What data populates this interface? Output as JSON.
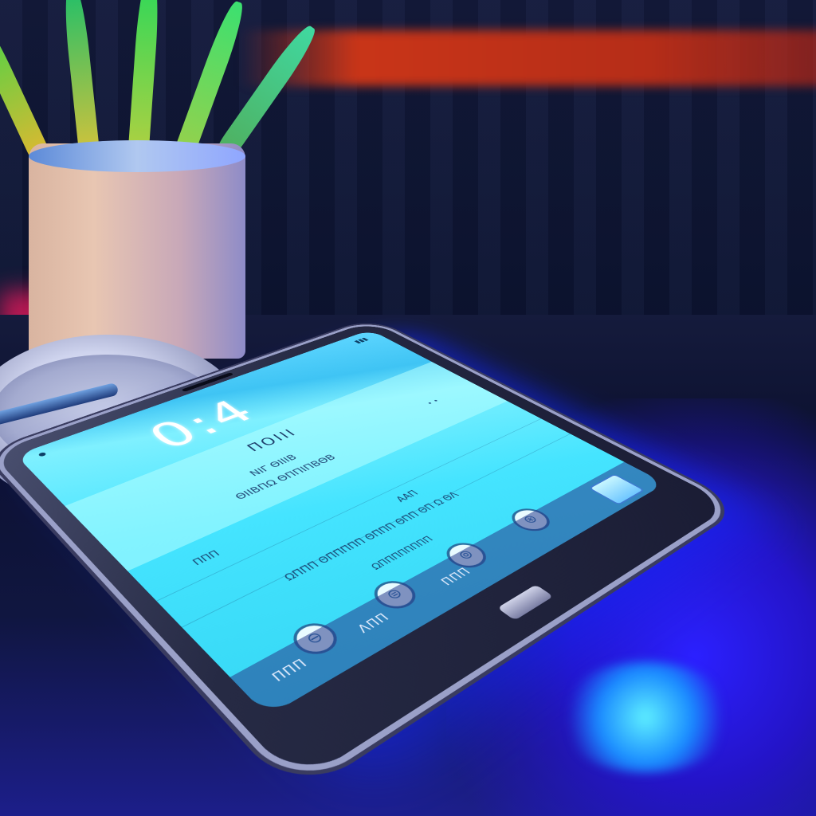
{
  "phone": {
    "clock": "0:4",
    "card": {
      "title": "ΠΟΙΙΙ",
      "line1": "ΝΙΓ ΘΙΙΙΒ",
      "line2": "ΘΙΙΒΠΩ ΘΠΠΙΠΒΘΒ"
    },
    "rows": [
      {
        "left": "ΠΠΠ",
        "right": ""
      },
      {
        "left": "",
        "right": "ΑΑΠ"
      }
    ],
    "body_line": "ΩΠΠΠ ΘΠΠΠΠΠ ΘΠΠΠ ΘΠΠ ΘΠ Ω ΘΛ",
    "body_line2": "ΩΠΠΠΠΠΠΠΠ",
    "apps": [
      {
        "glyph": "⊖",
        "label": ""
      },
      {
        "glyph": "⊜",
        "label": ""
      },
      {
        "glyph": "⊚",
        "label": ""
      },
      {
        "glyph": "⊛",
        "label": ""
      }
    ],
    "dock": {
      "item1": "ΠΠΠ",
      "item2": "ΛΠΠ",
      "item3": "ΠΠΠ"
    }
  }
}
